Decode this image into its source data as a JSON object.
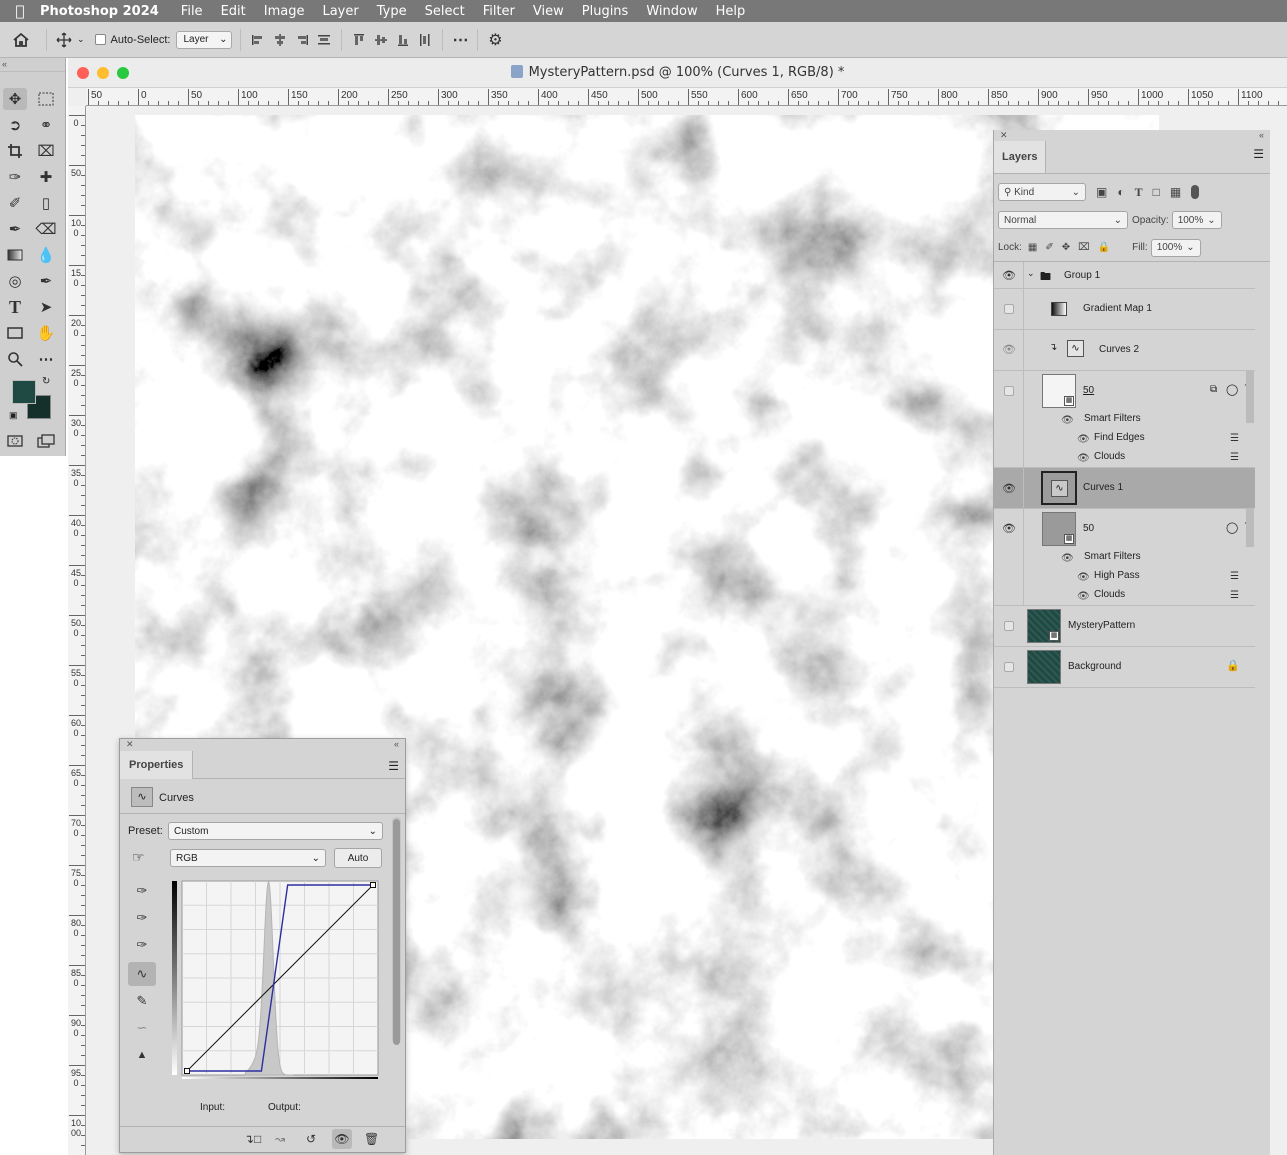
{
  "menubar": {
    "app_name": "Photoshop 2024",
    "items": [
      "File",
      "Edit",
      "Image",
      "Layer",
      "Type",
      "Select",
      "Filter",
      "View",
      "Plugins",
      "Window",
      "Help"
    ]
  },
  "options_bar": {
    "auto_select_label": "Auto-Select:",
    "auto_select_value": "Layer"
  },
  "document": {
    "title": "MysteryPattern.psd @ 100% (Curves 1, RGB/8) *",
    "h_ruler_labels": [
      "50",
      "0",
      "50",
      "100",
      "150",
      "200",
      "250",
      "300",
      "350",
      "400",
      "450",
      "500",
      "550",
      "600",
      "650",
      "700",
      "750",
      "800",
      "850",
      "900",
      "950",
      "1000",
      "1050",
      "1100"
    ],
    "v_ruler_labels": [
      "0",
      "50",
      "100",
      "150",
      "200",
      "250",
      "300",
      "350",
      "400",
      "450",
      "500",
      "550",
      "600",
      "650",
      "700",
      "750",
      "800",
      "850",
      "900",
      "950",
      "1000"
    ]
  },
  "colors": {
    "foreground": "#1f4a43",
    "background": "#15302b",
    "traffic_close": "#ff5f57",
    "traffic_min": "#febc2e",
    "traffic_max": "#28c840",
    "curve_blue": "#2b2fa0",
    "selected_layer": "#a9a9a9"
  },
  "layers_panel": {
    "tab": "Layers",
    "kind_label": "Kind",
    "blend_mode": "Normal",
    "opacity_label": "Opacity:",
    "opacity_value": "100%",
    "lock_label": "Lock:",
    "fill_label": "Fill:",
    "fill_value": "100%",
    "layers": {
      "group1": "Group 1",
      "gradient_map": "Gradient Map 1",
      "curves2": "Curves 2",
      "smart1_name": "50",
      "smart1_filters": "Smart Filters",
      "smart1_f1": "Find Edges",
      "smart1_f2": "Clouds",
      "curves1": "Curves 1",
      "smart2_name": "50",
      "smart2_filters": "Smart Filters",
      "smart2_f1": "High Pass",
      "smart2_f2": "Clouds",
      "mystery": "MysteryPattern",
      "background": "Background"
    }
  },
  "properties_panel": {
    "tab": "Properties",
    "type_label": "Curves",
    "preset_label": "Preset:",
    "preset_value": "Custom",
    "channel_value": "RGB",
    "auto_button": "Auto",
    "input_label": "Input:",
    "output_label": "Output:",
    "curve_points_input": [
      0,
      102,
      138,
      255
    ],
    "curve_points_output": [
      0,
      0,
      255,
      255
    ]
  }
}
